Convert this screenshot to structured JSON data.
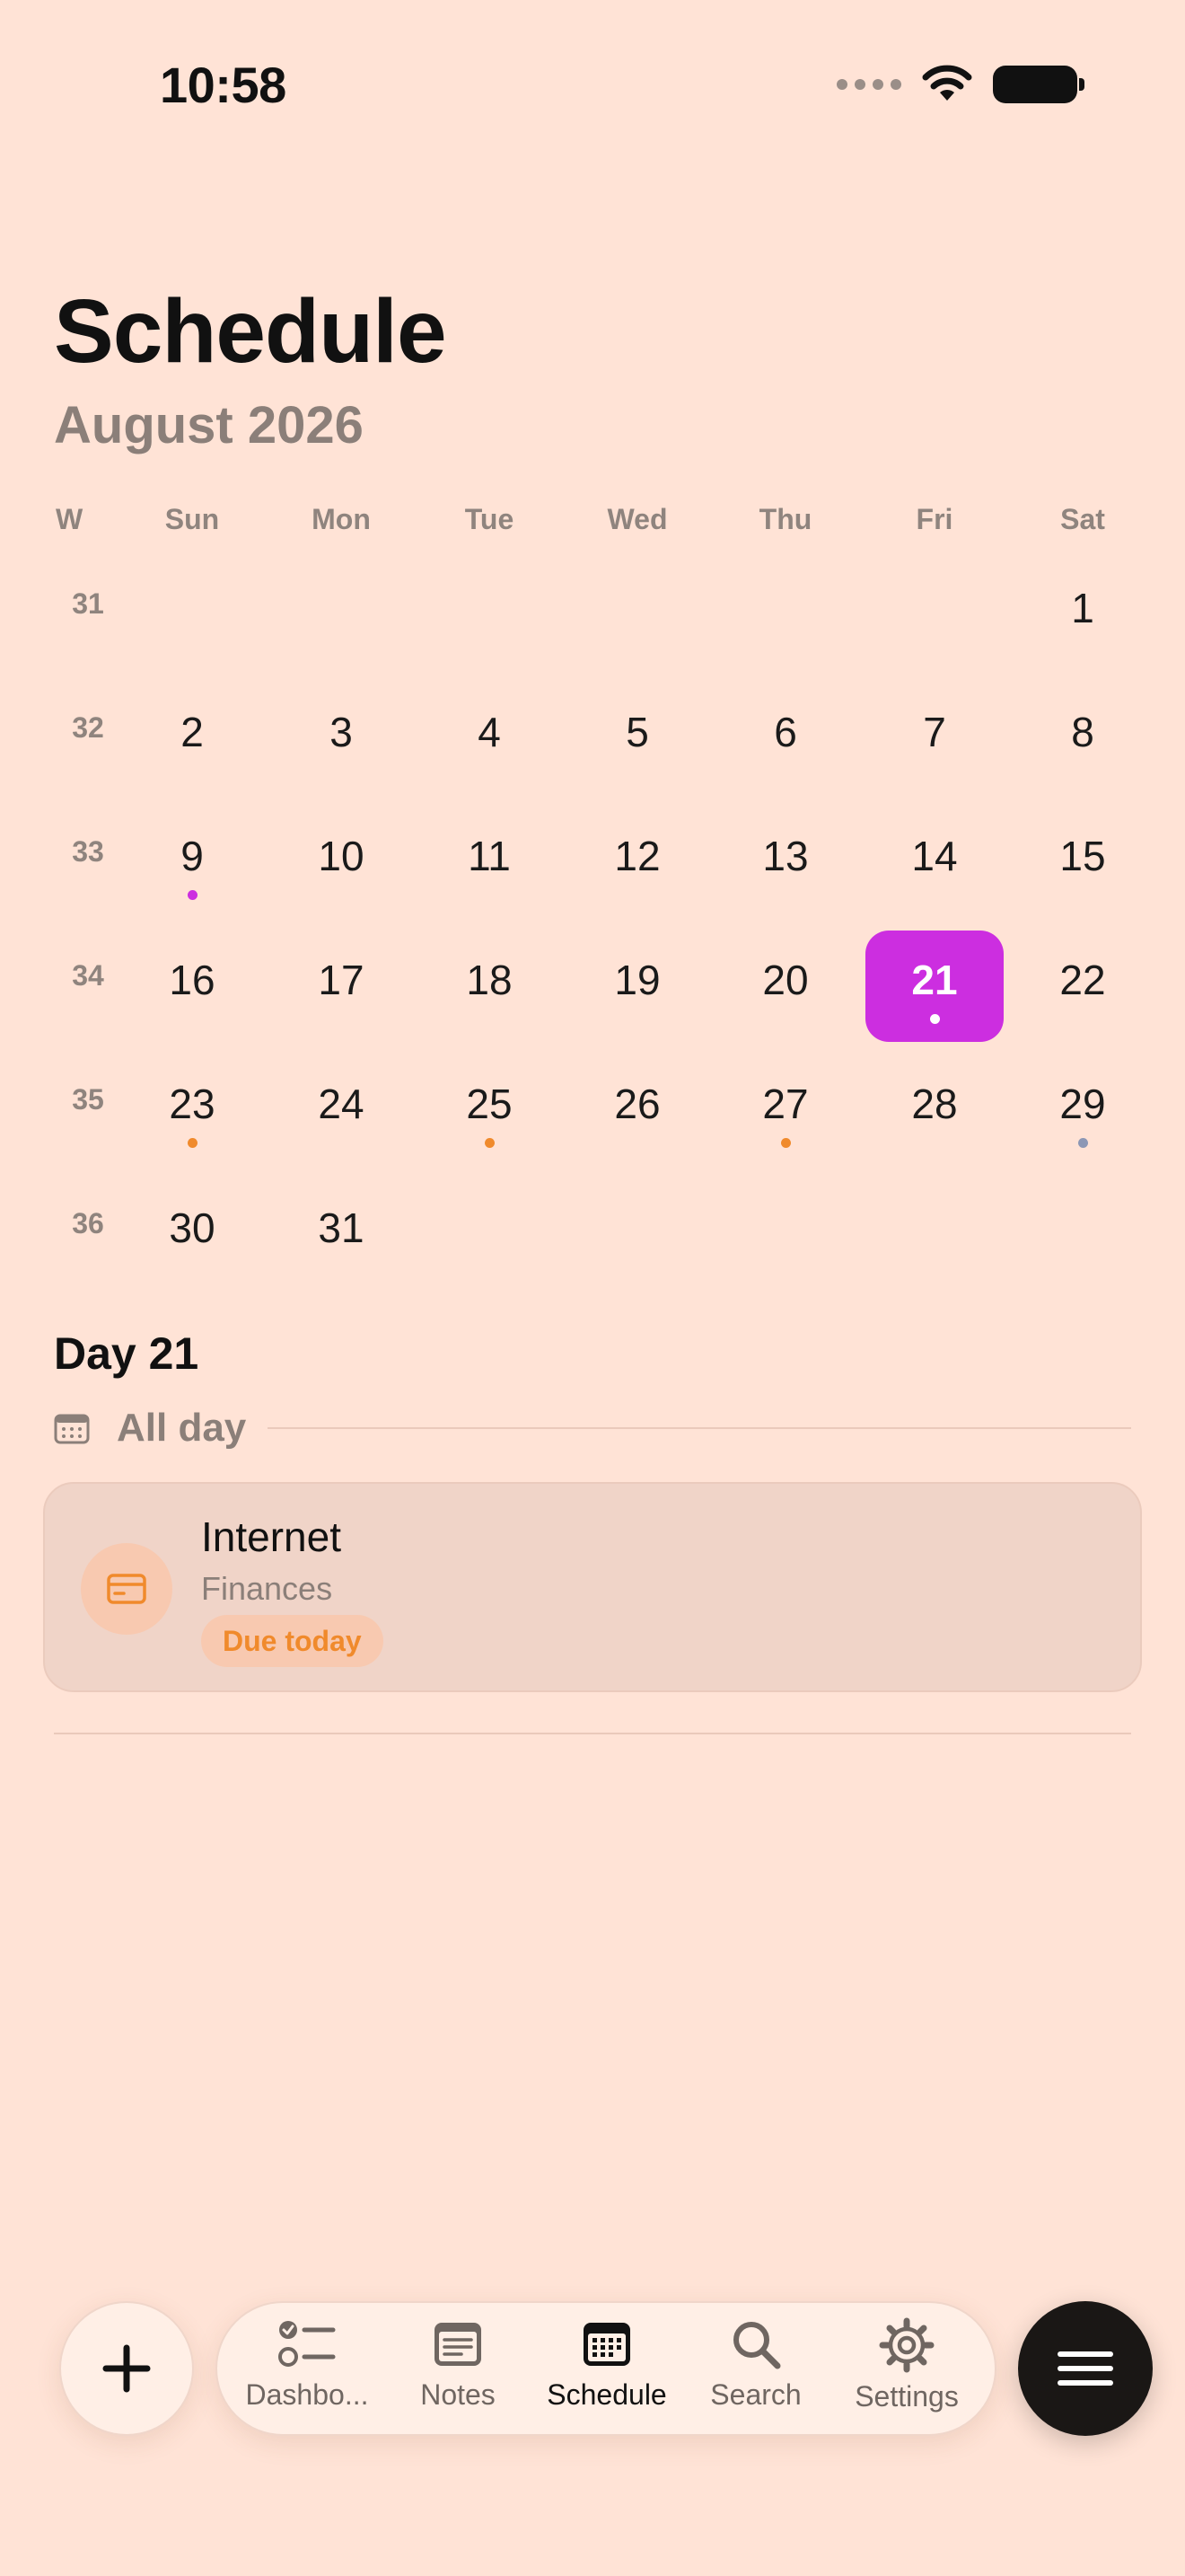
{
  "status_bar": {
    "time": "10:58"
  },
  "header": {
    "title": "Schedule",
    "subtitle": "August 2026"
  },
  "calendar": {
    "week_label": "W",
    "weekdays": [
      "Sun",
      "Mon",
      "Tue",
      "Wed",
      "Thu",
      "Fri",
      "Sat"
    ],
    "selected_day": 21,
    "weeks": [
      {
        "num": "31",
        "days": [
          "",
          "",
          "",
          "",
          "",
          "",
          "1"
        ]
      },
      {
        "num": "32",
        "days": [
          "2",
          "3",
          "4",
          "5",
          "6",
          "7",
          "8"
        ]
      },
      {
        "num": "33",
        "days": [
          "9",
          "10",
          "11",
          "12",
          "13",
          "14",
          "15"
        ]
      },
      {
        "num": "34",
        "days": [
          "16",
          "17",
          "18",
          "19",
          "20",
          "21",
          "22"
        ]
      },
      {
        "num": "35",
        "days": [
          "23",
          "24",
          "25",
          "26",
          "27",
          "28",
          "29"
        ]
      },
      {
        "num": "36",
        "days": [
          "30",
          "31",
          "",
          "",
          "",
          "",
          ""
        ]
      }
    ],
    "event_dots": {
      "9": "#CC2EE0",
      "21": "#FFFFFF",
      "23": "#F08A2C",
      "25": "#F08A2C",
      "27": "#F08A2C",
      "29": "#8C97B5"
    }
  },
  "day_section": {
    "heading": "Day 21",
    "all_day_label": "All day",
    "event": {
      "title": "Internet",
      "category": "Finances",
      "badge": "Due today",
      "icon": "credit-card-icon"
    }
  },
  "tab_bar": {
    "tabs": [
      {
        "label": "Dashbo...",
        "icon": "checklist-icon",
        "active": false
      },
      {
        "label": "Notes",
        "icon": "notes-icon",
        "active": false
      },
      {
        "label": "Schedule",
        "icon": "calendar-icon",
        "active": true
      },
      {
        "label": "Search",
        "icon": "search-icon",
        "active": false
      },
      {
        "label": "Settings",
        "icon": "gear-icon",
        "active": false
      }
    ]
  },
  "colors": {
    "background": "#FFE3D6",
    "accent": "#CC2EE0",
    "due": "#F08A2C"
  }
}
